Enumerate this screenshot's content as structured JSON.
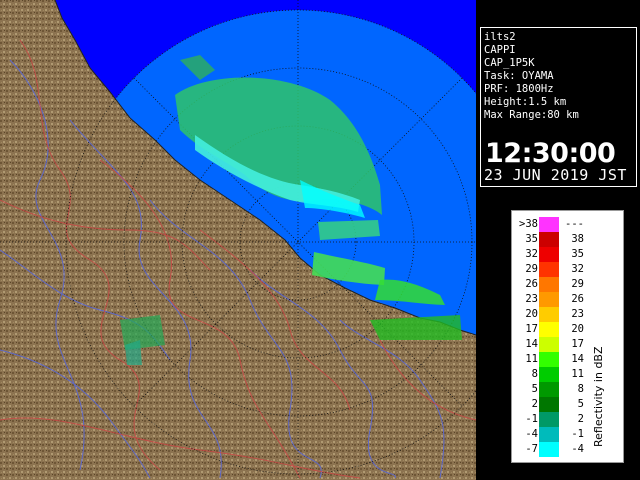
{
  "info": {
    "lines": [
      "ilts2",
      "CAPPI",
      "CAP_1P5K",
      "Task: OYAMA",
      "PRF: 1800Hz",
      "Height:1.5 km",
      "Max Range:80 km"
    ],
    "time": "12:30:00",
    "date": "23 JUN 2019 JST"
  },
  "legend": {
    "unit_label": "Reflectivity in dBZ",
    "bins": [
      {
        "low": ">38",
        "high": "---",
        "color": "#ff33ff"
      },
      {
        "low": "35",
        "high": "38",
        "color": "#cc0000"
      },
      {
        "low": "32",
        "high": "35",
        "color": "#ee0000"
      },
      {
        "low": "29",
        "high": "32",
        "color": "#ff3300"
      },
      {
        "low": "26",
        "high": "29",
        "color": "#ff7700"
      },
      {
        "low": "23",
        "high": "26",
        "color": "#ff9900"
      },
      {
        "low": "20",
        "high": "23",
        "color": "#ffcc00"
      },
      {
        "low": "17",
        "high": "20",
        "color": "#ffff00"
      },
      {
        "low": "14",
        "high": "17",
        "color": "#ccff00"
      },
      {
        "low": "11",
        "high": "14",
        "color": "#33ff00"
      },
      {
        "low": "8",
        "high": "11",
        "color": "#00cc00"
      },
      {
        "low": "5",
        "high": "8",
        "color": "#009900"
      },
      {
        "low": "2",
        "high": "5",
        "color": "#007700"
      },
      {
        "low": "-1",
        "high": "2",
        "color": "#009966"
      },
      {
        "low": "-4",
        "high": "-1",
        "color": "#00bbbb"
      },
      {
        "low": "-7",
        "high": "-4",
        "color": "#00ffff"
      }
    ]
  },
  "colors": {
    "sea_out_of_range": "#0000ff",
    "radar_coverage": "#0066ff",
    "land": "#8c7350"
  }
}
